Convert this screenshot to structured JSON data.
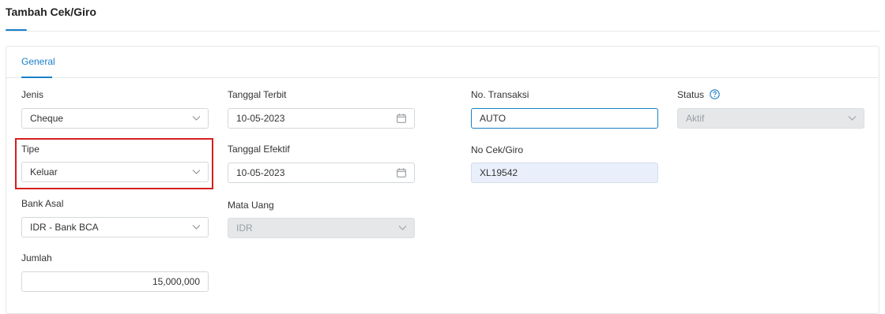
{
  "page": {
    "title": "Tambah Cek/Giro"
  },
  "tabs": {
    "general": "General"
  },
  "form": {
    "jenis": {
      "label": "Jenis",
      "value": "Cheque"
    },
    "tipe": {
      "label": "Tipe",
      "value": "Keluar"
    },
    "bank_asal": {
      "label": "Bank Asal",
      "value": "IDR - Bank BCA"
    },
    "jumlah": {
      "label": "Jumlah",
      "value": "15,000,000"
    },
    "tanggal_terbit": {
      "label": "Tanggal Terbit",
      "value": "10-05-2023"
    },
    "tanggal_efektif": {
      "label": "Tanggal Efektif",
      "value": "10-05-2023"
    },
    "mata_uang": {
      "label": "Mata Uang",
      "value": "IDR"
    },
    "no_transaksi": {
      "label": "No. Transaksi",
      "value": "AUTO"
    },
    "no_cek_giro": {
      "label": "No Cek/Giro",
      "value": "XL19542"
    },
    "status": {
      "label": "Status",
      "value": "Aktif"
    }
  },
  "colors": {
    "accent": "#1a7fc9",
    "highlight": "#d41f1f",
    "disabled_bg": "#e5e7e9",
    "readonly_bg": "#eaf0fb"
  }
}
